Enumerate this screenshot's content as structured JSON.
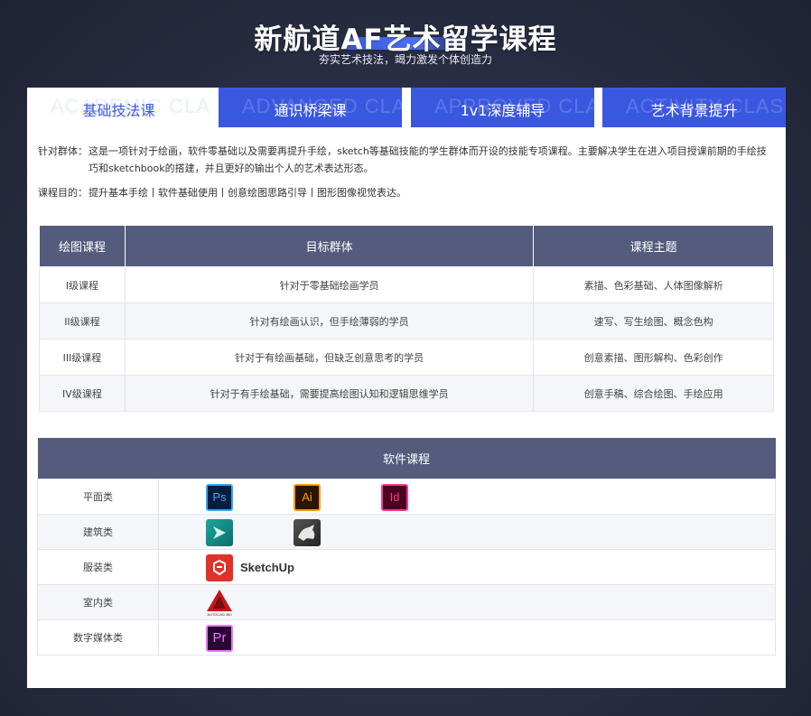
{
  "header": {
    "title": "新航道AF艺术留学课程",
    "subtitle": "夯实艺术技法，竭力激发个体创造力"
  },
  "tabs": [
    {
      "label": "基础技法课",
      "bg_text": "ACADEMIC CLASS",
      "active": true
    },
    {
      "label": "通识桥梁课",
      "bg_text": "ADVANCED CLASS",
      "active": false
    },
    {
      "label": "1v1深度辅导",
      "bg_text": "APPROVED CLASS",
      "active": false
    },
    {
      "label": "艺术背景提升",
      "bg_text": "ACTIVITY CLASS",
      "active": false
    }
  ],
  "description": {
    "audience_label": "针对群体：",
    "audience_text": "这是一项针对于绘画，软件零基础以及需要再提升手绘，sketch等基础技能的学生群体而开设的技能专项课程。主要解决学生在进入项目授课前期的手绘技巧和sketchbook的搭建，并且更好的输出个人的艺术表达形态。",
    "purpose_label": "课程目的：",
    "purpose_text": "提升基本手绘丨软件基础使用丨创意绘图思路引导丨图形图像视觉表达。"
  },
  "drawing_table": {
    "headers": [
      "绘图课程",
      "目标群体",
      "课程主题"
    ],
    "rows": [
      [
        "I级课程",
        "针对于零基础绘画学员",
        "素描、色彩基础、人体图像解析"
      ],
      [
        "II级课程",
        "针对有绘画认识，但手绘薄弱的学员",
        "速写、写生绘图、概念色构"
      ],
      [
        "III级课程",
        "针对于有绘画基础，但缺乏创意思考的学员",
        "创意素描、图形解构、色彩创作"
      ],
      [
        "IV级课程",
        "针对于有手绘基础，需要提高绘图认知和逻辑思维学员",
        "创意手稿、综合绘图、手绘应用"
      ]
    ]
  },
  "software_table": {
    "header": "软件课程",
    "rows": [
      {
        "category": "平面类",
        "apps": [
          {
            "icon": "photoshop-icon",
            "label": "Ps"
          },
          {
            "icon": "illustrator-icon",
            "label": "Ai"
          },
          {
            "icon": "indesign-icon",
            "label": "Id"
          }
        ]
      },
      {
        "category": "建筑类",
        "apps": [
          {
            "icon": "3dsmax-icon",
            "label": ""
          },
          {
            "icon": "rhino-icon",
            "label": ""
          }
        ]
      },
      {
        "category": "服装类",
        "apps": [
          {
            "icon": "sketchup-icon",
            "label": "SketchUp"
          }
        ]
      },
      {
        "category": "室内类",
        "apps": [
          {
            "icon": "autocad-icon",
            "label": "AUTOCAD 360"
          }
        ]
      },
      {
        "category": "数字媒体类",
        "apps": [
          {
            "icon": "premiere-icon",
            "label": "Pr"
          }
        ]
      }
    ]
  },
  "colors": {
    "accent": "#3a57e0",
    "table_header": "#545b7c",
    "background": "#2a3048"
  }
}
